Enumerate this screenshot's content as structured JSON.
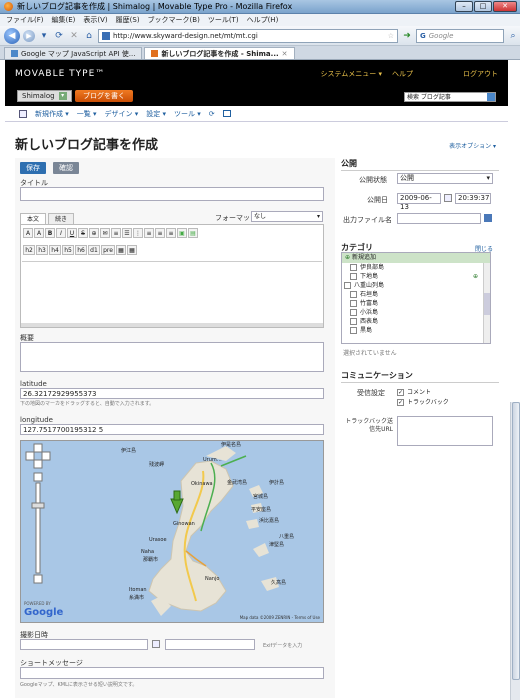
{
  "browser": {
    "window_title": "新しいブログ記事を作成 | Shimalog | Movable Type Pro - Mozilla Firefox",
    "menu": [
      "ファイル(F)",
      "編集(E)",
      "表示(V)",
      "履歴(S)",
      "ブックマーク(B)",
      "ツール(T)",
      "ヘルプ(H)"
    ],
    "url": "http://www.skyward-design.net/mt/mt.cgi",
    "search_placeholder": "Google",
    "tabs": [
      {
        "label": "Google マップ JavaScript API 使...",
        "active": false
      },
      {
        "label": "新しいブログ記事を作成 - Shima...",
        "active": true
      }
    ]
  },
  "mt": {
    "logo": "MOVABLE TYPE™",
    "system_menu": "システムメニュー ▾",
    "help": "ヘルプ",
    "logout": "ログアウト",
    "blog_name": "Shimalog",
    "write_button": "ブログを書く",
    "search_label": "検索 ブログ記事",
    "nav": [
      "新規作成 ▾",
      "一覧 ▾",
      "デザイン ▾",
      "設定 ▾",
      "ツール ▾"
    ]
  },
  "page": {
    "title": "新しいブログ記事を作成",
    "display_options": "表示オプション ▾",
    "save_button": "保存",
    "preview_button": "確認",
    "title_label": "タイトル",
    "editor_tabs": [
      "本文",
      "続き"
    ],
    "format_label": "フォーマット:",
    "format_value": "なし",
    "toolbar_row1": [
      "A",
      "A",
      "B",
      "I",
      "U",
      "S",
      "⊕",
      "✉",
      "≡",
      "☰",
      "⋮",
      "≡",
      "≡",
      "≡",
      "▣",
      "▤"
    ],
    "toolbar_row2": [
      "h2",
      "h3",
      "h4",
      "h5",
      "h6",
      "d1",
      "pre",
      "▦",
      "▦"
    ],
    "excerpt_label": "概要",
    "latitude_label": "latitude",
    "latitude_value": "26.32172929955373",
    "latitude_hint": "下の地図のマーカをドラッグすると、自動で入力されます。",
    "longitude_label": "longitude",
    "longitude_value": "127.7517700195312 5",
    "date_label": "撮影日時",
    "exif_hint": "Exifデータを入力",
    "short_message_label": "ショートメッセージ",
    "short_message_hint": "Googleマップ、KMLに表示させる短い説明文です。"
  },
  "map": {
    "places": [
      "伊是名島",
      "伊江島",
      "残波岬",
      "Urum…",
      "Okinawa",
      "金武湾島",
      "伊計島",
      "宮城島",
      "平安座島",
      "浜比嘉島",
      "Ginowan",
      "Urasoe",
      "Naha",
      "那覇市",
      "津堅島",
      "Nanjo",
      "Itoman",
      "糸満市",
      "久高島",
      "八重島"
    ],
    "attribution": "Map data ©2009 ZENRIN - Terms of Use",
    "powered_by": "POWERED BY",
    "google": "Google"
  },
  "sidebar": {
    "publish_head": "公開",
    "status_label": "公開状態",
    "status_value": "公開",
    "date_label": "公開日",
    "date_value": "2009-06-13",
    "time_value": "20:39:37",
    "filename_label": "出力ファイル名",
    "category_head": "カテゴリ",
    "category_action": "閉じる",
    "new_category": "新規追加",
    "categories": [
      {
        "label": "伊良部島",
        "indent": 1,
        "checked": false
      },
      {
        "label": "下地島",
        "indent": 1,
        "checked": false
      },
      {
        "label": "八重山列島",
        "indent": 0,
        "checked": false
      },
      {
        "label": "石垣島",
        "indent": 1,
        "checked": false
      },
      {
        "label": "竹富島",
        "indent": 1,
        "checked": false
      },
      {
        "label": "小浜島",
        "indent": 1,
        "checked": false
      },
      {
        "label": "西表島",
        "indent": 1,
        "checked": false
      },
      {
        "label": "黒島",
        "indent": 1,
        "checked": false
      }
    ],
    "no_selection": "選択されていません",
    "community_head": "コミュニケーション",
    "receive_label": "受信設定",
    "comments": "コメント",
    "trackbacks": "トラックバック",
    "trackback_label": "トラックバック送信先URL"
  },
  "colors": {
    "accent_orange": "#e0641a",
    "mt_black": "#000000",
    "link_blue": "#2060a0",
    "save_blue": "#2e6fb0"
  }
}
